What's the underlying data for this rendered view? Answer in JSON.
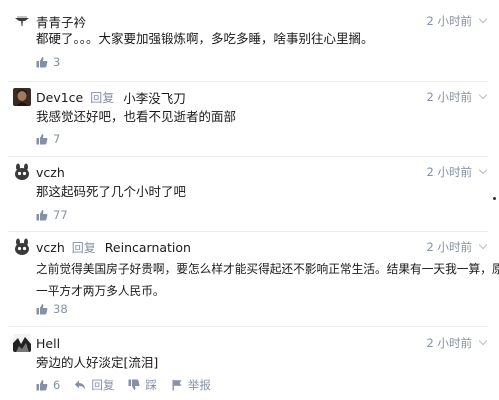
{
  "comments": [
    {
      "author": "青青子衿",
      "time": "2 小时前",
      "text": "都硬了。。。大家要加强锻炼啊，多吃多睡，啥事别往心里搁。",
      "likes": "3"
    },
    {
      "author": "Dev1ce",
      "reply_word": "回复",
      "reply_to": "小李没飞刀",
      "time": "2 小时前",
      "text": "我感觉还好吧，也看不见逝者的面部",
      "likes": "7"
    },
    {
      "author": "vczh",
      "time": "2 小时前",
      "text": "那这起码死了几个小时了吧",
      "likes": "77"
    },
    {
      "author": "vczh",
      "reply_word": "回复",
      "reply_to": "Reincarnation",
      "time": "2 小时前",
      "text_line1": "之前觉得美国房子好贵啊，要怎么样才能买得起还不影响正常生活。结果有一天我一算，原来",
      "text_line2": "一平方才两万多人民币。",
      "likes": "38"
    },
    {
      "author": "Hell",
      "time": "2 小时前",
      "text": "旁边的人好淡定[流泪]",
      "likes": "6",
      "action_reply": "回复",
      "action_dislike": "踩",
      "action_report": "举报"
    }
  ],
  "icons": {
    "like": "thumbs-up-icon",
    "reply": "reply-arrow-icon",
    "dislike": "thumbs-down-icon",
    "report": "flag-icon",
    "menu": "chevron-down-icon"
  },
  "colors": {
    "meta": "#8590a6",
    "text": "#1a1a1a",
    "divider": "#ececec"
  }
}
